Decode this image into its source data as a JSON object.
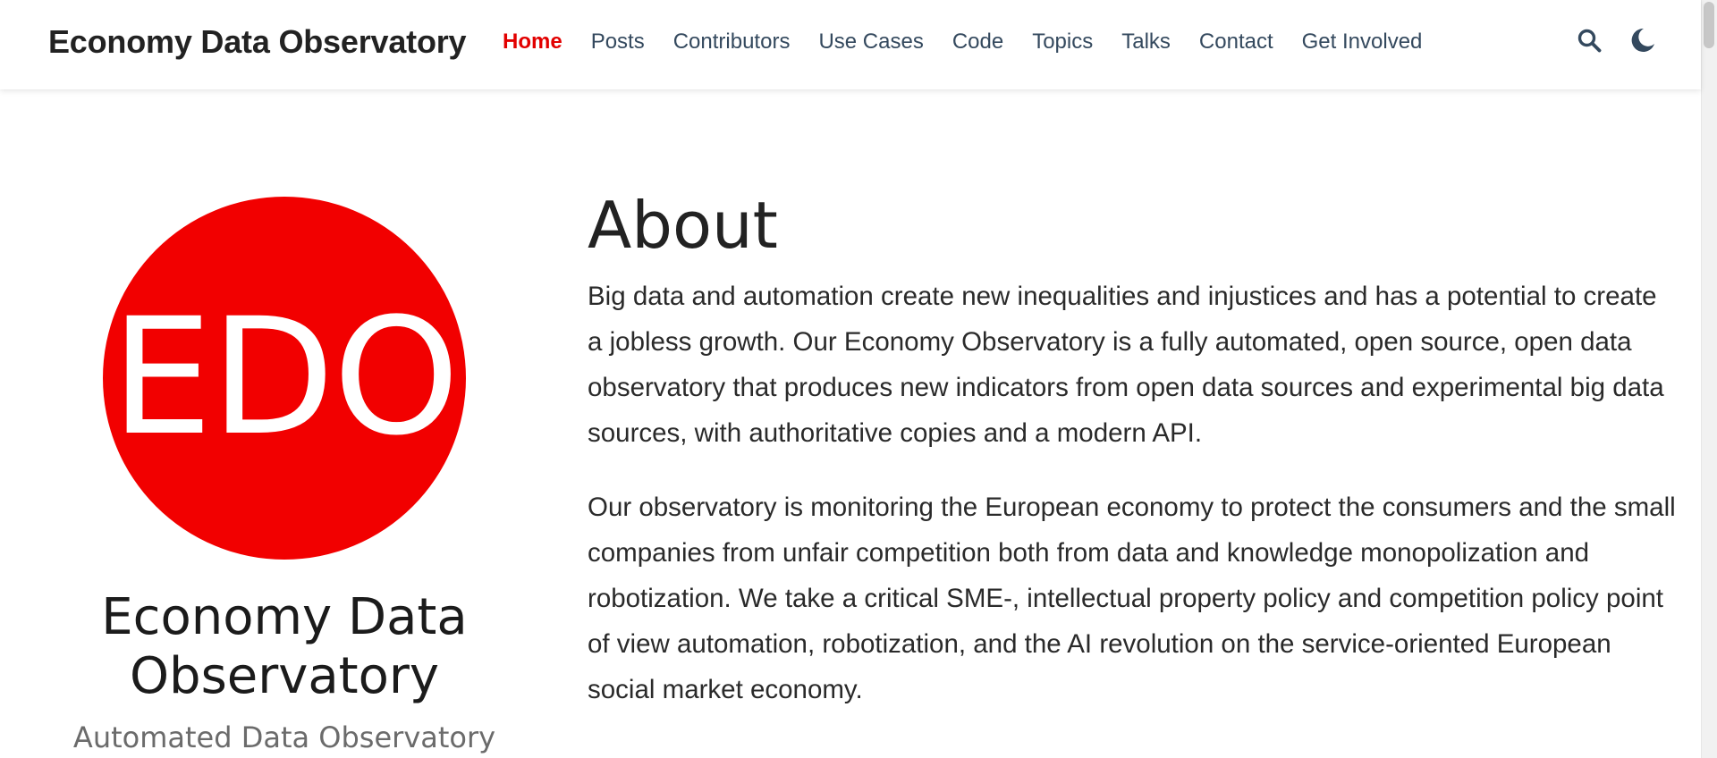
{
  "site": {
    "brand": "Economy Data Observatory"
  },
  "nav": {
    "items": [
      {
        "label": "Home",
        "active": true
      },
      {
        "label": "Posts"
      },
      {
        "label": "Contributors"
      },
      {
        "label": "Use Cases"
      },
      {
        "label": "Code"
      },
      {
        "label": "Topics"
      },
      {
        "label": "Talks"
      },
      {
        "label": "Contact"
      },
      {
        "label": "Get Involved"
      }
    ],
    "actions": [
      {
        "icon": "search-icon"
      },
      {
        "icon": "moon-icon"
      }
    ]
  },
  "profile": {
    "logo_text": "EDO",
    "logo_color": "#f20000",
    "name_line1": "Economy Data",
    "name_line2": "Observatory",
    "subtitle": "Automated Data Observatory"
  },
  "main": {
    "title": "About",
    "paragraphs": [
      "Big data and automation create new inequalities and injustices and has a potential to create a jobless growth. Our Economy Observatory is a fully automated, open source, open data observatory that produces new indicators from open data sources and experimental big data sources, with authoritative copies and a modern API.",
      "Our observatory is monitoring the European economy to protect the consumers and the small companies from unfair competition both from data and knowledge monopolization and robotization. We take a critical SME-, intellectual property policy and competition policy point of view automation, robotization, and the AI revolution on the service-oriented European social market economy."
    ]
  },
  "colors": {
    "accent": "#e20000",
    "nav_text": "#34495e"
  }
}
